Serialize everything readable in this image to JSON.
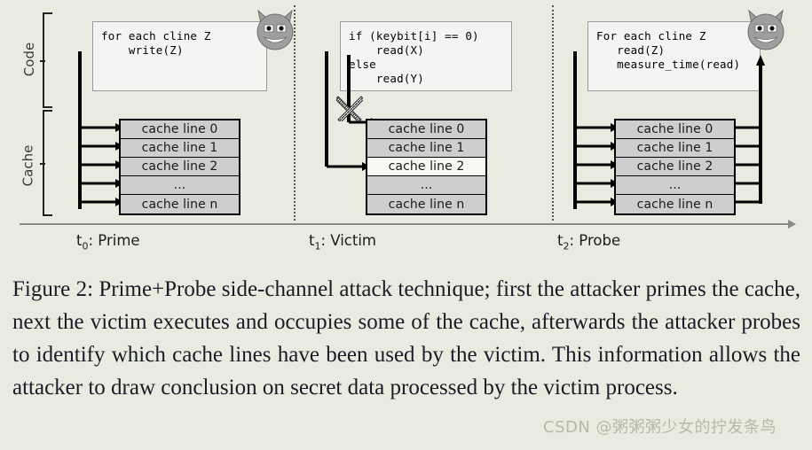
{
  "figure": {
    "row_labels": [
      {
        "name": "code",
        "text": "Code"
      },
      {
        "name": "cache",
        "text": "Cache"
      }
    ],
    "panels": [
      {
        "id": "prime",
        "code": "for each cline Z\n    write(Z)",
        "has_attacker": true,
        "cache_lines": [
          {
            "label": "cache line 0",
            "filled": true
          },
          {
            "label": "cache line 1",
            "filled": true
          },
          {
            "label": "cache line 2",
            "filled": true
          },
          {
            "label": "...",
            "filled": true
          },
          {
            "label": "cache line n",
            "filled": true
          }
        ],
        "time_label": "Prime",
        "time_index": "0"
      },
      {
        "id": "victim",
        "code": "if (keybit[i] == 0)\n    read(X)\nelse\n    read(Y)",
        "has_attacker": false,
        "cache_lines": [
          {
            "label": "cache line 0",
            "filled": true
          },
          {
            "label": "cache line 1",
            "filled": true
          },
          {
            "label": "cache line 2",
            "filled": false
          },
          {
            "label": "...",
            "filled": true
          },
          {
            "label": "cache line n",
            "filled": true
          }
        ],
        "time_label": "Victim",
        "time_index": "1"
      },
      {
        "id": "probe",
        "code": "For each cline Z\n   read(Z)\n   measure_time(read)",
        "has_attacker": true,
        "cache_lines": [
          {
            "label": "cache line 0",
            "filled": true
          },
          {
            "label": "cache line 1",
            "filled": true
          },
          {
            "label": "cache line 2",
            "filled": true
          },
          {
            "label": "...",
            "filled": true
          },
          {
            "label": "cache line n",
            "filled": true
          }
        ],
        "time_label": "Probe",
        "time_index": "2"
      }
    ]
  },
  "caption": "Figure 2: Prime+Probe side-channel attack technique; first the attacker primes the cache, next the victim executes and occupies some of the cache, afterwards the attacker probes to identify which cache lines have been used by the victim. This information allows the attacker to draw conclusion on secret data processed by the victim process.",
  "watermark": "CSDN @粥粥粥少女的拧发条鸟",
  "colors": {
    "background": "#e8ece0",
    "cache_fill": "#cecece",
    "cache_empty": "#f7f8f4",
    "code_box": "#f4f4f2",
    "devil": "#9e9e9e",
    "timeline": "#8a8a8a"
  }
}
